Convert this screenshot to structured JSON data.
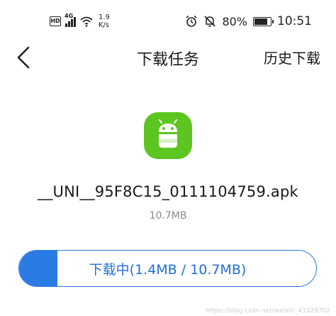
{
  "status_bar": {
    "hd": "HD",
    "network_type": "4G",
    "speed_value": "1.9",
    "speed_unit": "K/s",
    "battery": "80%",
    "battery_level": 0.8,
    "time": "10:51"
  },
  "header": {
    "title": "下载任务",
    "history_label": "历史下载"
  },
  "file": {
    "name": "__UNI__95F8C15_0111104759.apk",
    "size": "10.7MB"
  },
  "download": {
    "label": "下载中(1.4MB / 10.7MB)",
    "progress": 0.13,
    "accent": "#2b7be4"
  },
  "icons": {
    "back": "back-chevron-icon",
    "app": "android-app-icon",
    "alarm": "alarm-icon",
    "mute": "bell-off-icon",
    "wifi": "wifi-icon"
  },
  "watermark": "https://blog.csdn.net/weixin_43329702"
}
